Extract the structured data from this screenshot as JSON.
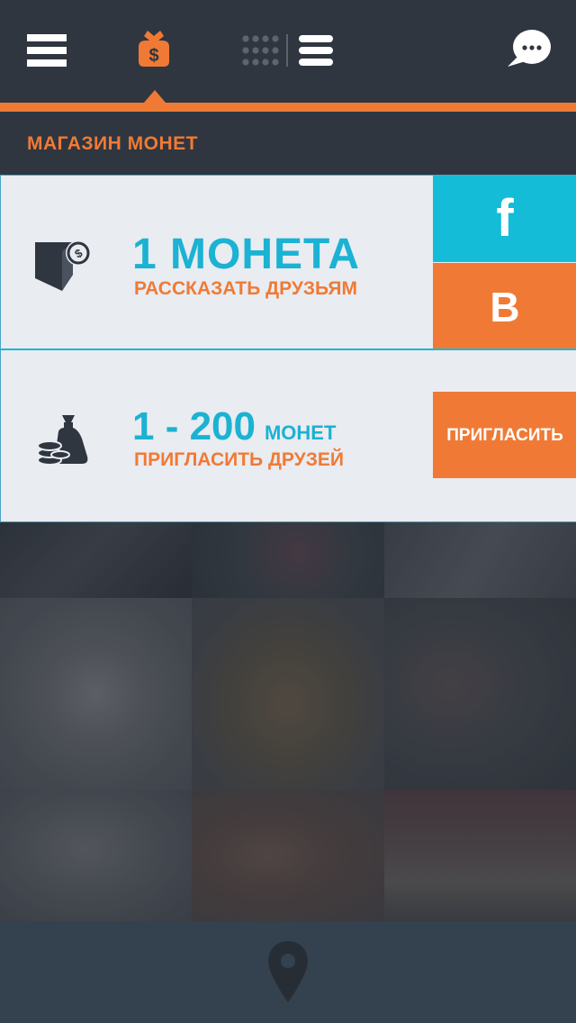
{
  "header": {
    "icons": [
      "menu-icon",
      "wallet-icon",
      "grid-view-icon",
      "list-view-icon",
      "chat-icon"
    ],
    "accent_color": "#f07a35",
    "background_color": "#2f3640"
  },
  "shop": {
    "title": "МАГАЗИН МОНЕТ",
    "offers": [
      {
        "amount": "1 МОНЕТА",
        "caption": "РАССКАЗАТЬ ДРУЗЬЯМ",
        "icon": "wallet-coin-icon",
        "share_buttons": [
          {
            "label": "f",
            "icon": "facebook-icon",
            "color": "#14bcd8"
          },
          {
            "label": "В",
            "icon": "vkontakte-icon",
            "color": "#f07a35"
          }
        ]
      },
      {
        "amount": "1 - 200",
        "unit": "МОНЕТ",
        "caption": "ПРИГЛАСИТЬ ДРУЗЕЙ",
        "icon": "money-bag-coins-icon",
        "button_label": "ПРИГЛАСИТЬ"
      }
    ]
  },
  "bottom_bar": {
    "icon": "location-pin-icon"
  }
}
